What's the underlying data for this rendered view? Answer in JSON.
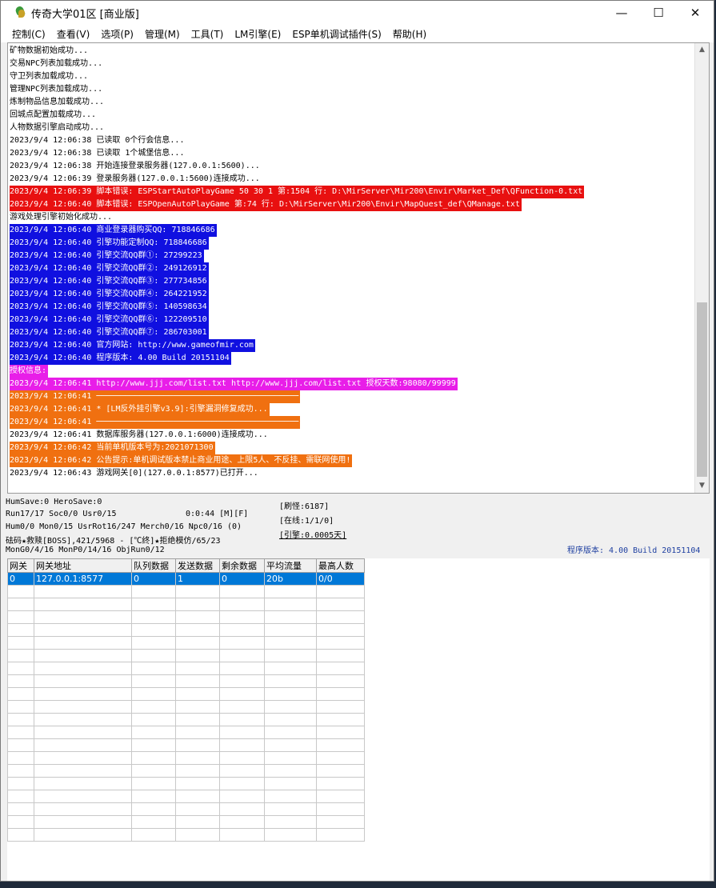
{
  "window": {
    "title": "传奇大学01区 [商业版]",
    "controls": {
      "minimize": "—",
      "maximize": "☐",
      "close": "✕"
    }
  },
  "menu": [
    "控制(C)",
    "查看(V)",
    "选项(P)",
    "管理(M)",
    "工具(T)",
    "LM引擎(E)",
    "ESP单机调试插件(S)",
    "帮助(H)"
  ],
  "log": [
    {
      "text": "矿物数据初始成功...",
      "bg": "",
      "color": "#000000"
    },
    {
      "text": "交易NPC列表加载成功...",
      "bg": "",
      "color": "#000000"
    },
    {
      "text": "守卫列表加载成功...",
      "bg": "",
      "color": "#000000"
    },
    {
      "text": "管理NPC列表加载成功...",
      "bg": "",
      "color": "#000000"
    },
    {
      "text": "炼制物品信息加载成功...",
      "bg": "",
      "color": "#000000"
    },
    {
      "text": "回城点配置加载成功...",
      "bg": "",
      "color": "#000000"
    },
    {
      "text": "人物数据引擎启动成功...",
      "bg": "",
      "color": "#000000"
    },
    {
      "text": "2023/9/4 12:06:38 已读取 0个行会信息...",
      "bg": "",
      "color": "#000000"
    },
    {
      "text": "2023/9/4 12:06:38 已读取 1个城堡信息...",
      "bg": "",
      "color": "#000000"
    },
    {
      "text": "2023/9/4 12:06:38 开始连接登录服务器(127.0.0.1:5600)...",
      "bg": "",
      "color": "#000000"
    },
    {
      "text": "2023/9/4 12:06:39 登录服务器(127.0.0.1:5600)连接成功...",
      "bg": "",
      "color": "#000000"
    },
    {
      "text": "2023/9/4 12:06:39 脚本错误: ESPStartAutoPlayGame 50 30 1 第:1504 行: D:\\MirServer\\Mir200\\Envir\\Market_Def\\QFunction-0.txt",
      "bg": "#e81010",
      "color": "#ffffff"
    },
    {
      "text": "2023/9/4 12:06:40 脚本错误: ESPOpenAutoPlayGame 第:74 行: D:\\MirServer\\Mir200\\Envir\\MapQuest_def\\QManage.txt",
      "bg": "#e81010",
      "color": "#ffffff"
    },
    {
      "text": "游戏处理引擎初始化成功...",
      "bg": "",
      "color": "#000000"
    },
    {
      "text": "2023/9/4 12:06:40 商业登录器购买QQ: 718846686",
      "bg": "#1010e0",
      "color": "#ffffff"
    },
    {
      "text": "2023/9/4 12:06:40 引擎功能定制QQ: 718846686",
      "bg": "#1010e0",
      "color": "#ffffff"
    },
    {
      "text": "2023/9/4 12:06:40 引擎交流QQ群①: 27299223",
      "bg": "#1010e0",
      "color": "#ffffff"
    },
    {
      "text": "2023/9/4 12:06:40 引擎交流QQ群②: 249126912",
      "bg": "#1010e0",
      "color": "#ffffff"
    },
    {
      "text": "2023/9/4 12:06:40 引擎交流QQ群③: 277734856",
      "bg": "#1010e0",
      "color": "#ffffff"
    },
    {
      "text": "2023/9/4 12:06:40 引擎交流QQ群④: 264221952",
      "bg": "#1010e0",
      "color": "#ffffff"
    },
    {
      "text": "2023/9/4 12:06:40 引擎交流QQ群⑤: 140598634",
      "bg": "#1010e0",
      "color": "#ffffff"
    },
    {
      "text": "2023/9/4 12:06:40 引擎交流QQ群⑥: 122209510",
      "bg": "#1010e0",
      "color": "#ffffff"
    },
    {
      "text": "2023/9/4 12:06:40 引擎交流QQ群⑦: 286703001",
      "bg": "#1010e0",
      "color": "#ffffff"
    },
    {
      "text": "2023/9/4 12:06:40 官方网站: http://www.gameofmir.com",
      "bg": "#1010e0",
      "color": "#ffffff"
    },
    {
      "text": "2023/9/4 12:06:40 程序版本: 4.00 Build 20151104",
      "bg": "#1010e0",
      "color": "#ffffff"
    },
    {
      "text": "授权信息:",
      "bg": "#e81ee8",
      "color": "#ffffff"
    },
    {
      "text": "2023/9/4 12:06:41 http://www.jjj.com/list.txt http://www.jjj.com/list.txt 授权天数:98080/99999",
      "bg": "#e81ee8",
      "color": "#ffffff"
    },
    {
      "text": "2023/9/4 12:06:41 ──────────────────────────────────────────",
      "bg": "#f07010",
      "color": "#ffffff"
    },
    {
      "text": "2023/9/4 12:06:41 * [LM反外挂引擎v3.9]:引擎漏洞修复成功...    ",
      "bg": "#f07010",
      "color": "#ffffff"
    },
    {
      "text": "2023/9/4 12:06:41 ──────────────────────────────────────────",
      "bg": "#f07010",
      "color": "#ffffff"
    },
    {
      "text": "2023/9/4 12:06:41 数据库服务器(127.0.0.1:6000)连接成功...",
      "bg": "",
      "color": "#000000"
    },
    {
      "text": "2023/9/4 12:06:42 当前单机版本号为:2021071300",
      "bg": "#f07010",
      "color": "#ffffff"
    },
    {
      "text": "2023/9/4 12:06:42 公告提示:单机调试版本禁止商业用途、上限5人、不反挂、需联网使用!",
      "bg": "#f07010",
      "color": "#ffffff"
    },
    {
      "text": "2023/9/4 12:06:43 游戏网关[0](127.0.0.1:8577)已打开...",
      "bg": "",
      "color": "#000000"
    }
  ],
  "status": {
    "save": "HumSave:0 HeroSave:0",
    "run": "Run17/17 Soc0/0 Usr0/15",
    "time": "0:0:44 [M][F]",
    "hum": "Hum0/0 Mon0/15 UsrRot16/247 Merch0/16 Npc0/16 (0)",
    "boss": "砝码★救赎[BOSS],421/5968 - [℃终]★拒绝模仿/65/23",
    "mon": "MonG0/4/16 MonP0/14/16 ObjRun0/12",
    "refresh": "[刷怪:6187]",
    "online": "[在线:1/1/0]",
    "engine": "[引擎:0.0005天]",
    "version": "程序版本: 4.00 Build 20151104"
  },
  "gateway": {
    "headers": [
      "网关",
      "网关地址",
      "队列数据",
      "发送数据",
      "剩余数据",
      "平均流量",
      "最高人数"
    ],
    "rows": [
      [
        "0",
        "127.0.0.1:8577",
        "0",
        "1",
        "0",
        "20b",
        "0/0"
      ]
    ]
  },
  "colors": {
    "accent": "#0078d7"
  }
}
